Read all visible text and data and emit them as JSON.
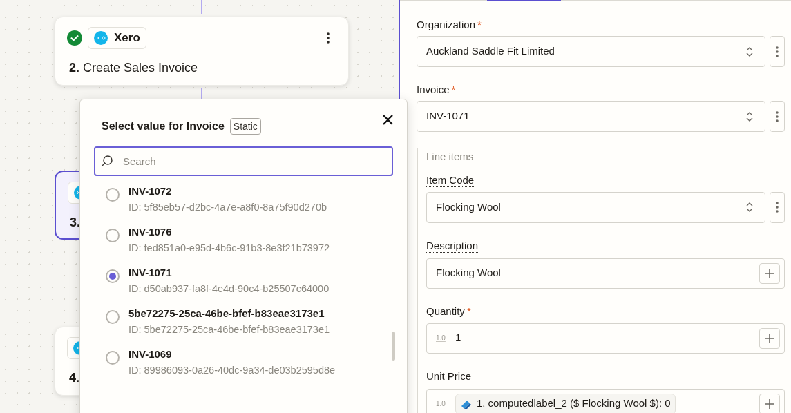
{
  "canvas": {
    "steps": [
      {
        "number": "2.",
        "app": "Xero",
        "title": "Create Sales Invoice",
        "completed": true,
        "selected": false
      },
      {
        "number": "3.",
        "selected": true
      },
      {
        "number": "4.",
        "selected": false
      }
    ]
  },
  "picker": {
    "title": "Select value for Invoice",
    "badge": "Static",
    "search": {
      "placeholder": "Search"
    },
    "options": [
      {
        "label": "INV-1072",
        "id": "ID: 5f85eb57-d2bc-4a7e-a8f0-8a75f90d270b",
        "selected": false
      },
      {
        "label": "INV-1076",
        "id": "ID: fed851a0-e95d-4b6c-91b3-8e3f21b73972",
        "selected": false
      },
      {
        "label": "INV-1071",
        "id": "ID: d50ab937-fa8f-4e4d-90c4-b25507c64000",
        "selected": true
      },
      {
        "label": "5be72275-25ca-46be-bfef-b83eae3173e1",
        "id": "ID: 5be72275-25ca-46be-bfef-b83eae3173e1",
        "selected": false
      },
      {
        "label": "INV-1069",
        "id": "ID: 89986093-0a26-40dc-9a34-de03b2595d8e",
        "selected": false
      }
    ]
  },
  "panel": {
    "fields": [
      {
        "kind": "select",
        "label": "Organization",
        "required_mark": "*",
        "help": false,
        "value": "Auckland Saddle Fit Limited"
      },
      {
        "kind": "select",
        "label": "Invoice",
        "required_mark": "*",
        "help": false,
        "value": "INV-1071"
      }
    ],
    "line_items": {
      "title": "Line items",
      "fields": [
        {
          "kind": "select",
          "label": "Item Code",
          "help": true,
          "value": "Flocking Wool"
        },
        {
          "kind": "text",
          "label": "Description",
          "help": true,
          "value": "Flocking Wool"
        },
        {
          "kind": "number",
          "label": "Quantity",
          "required_mark": "*",
          "help": false,
          "type_hint": "1.0",
          "value": "1"
        },
        {
          "kind": "mapped",
          "label": "Unit Price",
          "help": true,
          "type_hint": "1.0",
          "value": "1. computedlabel_2 ($ Flocking Wool $): 0"
        }
      ]
    }
  }
}
